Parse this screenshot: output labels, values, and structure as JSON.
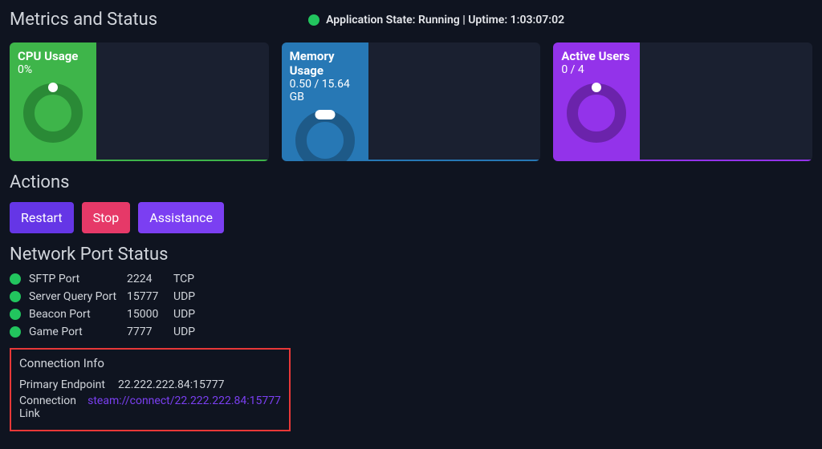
{
  "header": {
    "title": "Metrics and Status",
    "app_state_prefix": "Application State: ",
    "app_state": "Running",
    "uptime_prefix": " | Uptime: ",
    "uptime": "1:03:07:02"
  },
  "cards": {
    "cpu": {
      "title": "CPU Usage",
      "value": "0%"
    },
    "memory": {
      "title": "Memory Usage",
      "value": "0.50 / 15.64 GB"
    },
    "users": {
      "title": "Active Users",
      "value": "0 / 4"
    }
  },
  "sections": {
    "actions_title": "Actions",
    "network_title": "Network Port Status",
    "connection_title": "Connection Info"
  },
  "actions": {
    "restart": "Restart",
    "stop": "Stop",
    "assistance": "Assistance"
  },
  "ports": [
    {
      "name": "SFTP Port",
      "number": "2224",
      "protocol": "TCP"
    },
    {
      "name": "Server Query Port",
      "number": "15777",
      "protocol": "UDP"
    },
    {
      "name": "Beacon Port",
      "number": "15000",
      "protocol": "UDP"
    },
    {
      "name": "Game Port",
      "number": "7777",
      "protocol": "UDP"
    }
  ],
  "connection": {
    "primary_label": "Primary Endpoint",
    "primary_value": "22.222.222.84:15777",
    "link_label": "Connection Link",
    "link_value": "steam://connect/22.222.222.84:15777"
  }
}
